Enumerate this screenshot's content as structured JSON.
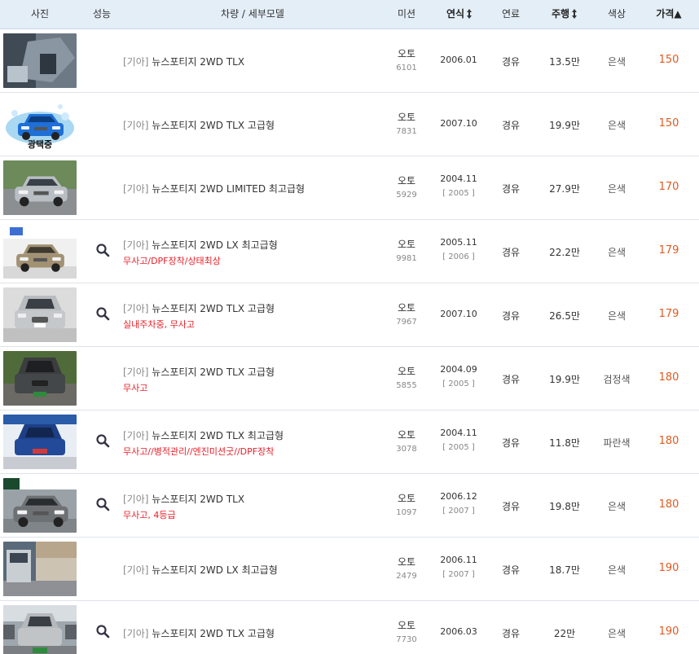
{
  "header": {
    "photo": "사진",
    "performance": "성능",
    "model": "차량 / 세부모델",
    "transmission": "미션",
    "year": "연식",
    "fuel": "연료",
    "mileage": "주행",
    "color": "색상",
    "price": "가격▲"
  },
  "rows": [
    {
      "maker": "[기아]",
      "model": "뉴스포티지 2WD TLX",
      "note": "",
      "trans": "오토",
      "code": "6101",
      "year": "2006.01",
      "year2": "",
      "fuel": "경유",
      "km": "13.5만",
      "color": "은색",
      "price": "150",
      "inspect": false,
      "thumb": "interior"
    },
    {
      "maker": "[기아]",
      "model": "뉴스포티지 2WD TLX 고급형",
      "note": "",
      "trans": "오토",
      "code": "7831",
      "year": "2007.10",
      "year2": "",
      "fuel": "경유",
      "km": "19.9만",
      "color": "은색",
      "price": "150",
      "inspect": false,
      "thumb": "wash",
      "thumb_label": "광택중"
    },
    {
      "maker": "[기아]",
      "model": "뉴스포티지 2WD LIMITED 최고급형",
      "note": "",
      "trans": "오토",
      "code": "5929",
      "year": "2004.11",
      "year2": "[ 2005 ]",
      "fuel": "경유",
      "km": "27.9만",
      "color": "은색",
      "price": "170",
      "inspect": false,
      "thumb": "silver"
    },
    {
      "maker": "[기아]",
      "model": "뉴스포티지 2WD LX 최고급형",
      "note": "무사고/DPF장착/상태최상",
      "trans": "오토",
      "code": "9981",
      "year": "2005.11",
      "year2": "[ 2006 ]",
      "fuel": "경유",
      "km": "22.2만",
      "color": "은색",
      "price": "179",
      "inspect": true,
      "thumb": "beige"
    },
    {
      "maker": "[기아]",
      "model": "뉴스포티지 2WD TLX 고급형",
      "note": "실내주차중, 무사고",
      "trans": "오토",
      "code": "7967",
      "year": "2007.10",
      "year2": "",
      "fuel": "경유",
      "km": "26.5만",
      "color": "은색",
      "price": "179",
      "inspect": true,
      "thumb": "front"
    },
    {
      "maker": "[기아]",
      "model": "뉴스포티지 2WD TLX 고급형",
      "note": "무사고",
      "trans": "오토",
      "code": "5855",
      "year": "2004.09",
      "year2": "[ 2005 ]",
      "fuel": "경유",
      "km": "19.9만",
      "color": "검정색",
      "price": "180",
      "inspect": false,
      "thumb": "dark"
    },
    {
      "maker": "[기아]",
      "model": "뉴스포티지 2WD TLX 최고급형",
      "note": "무사고//병적관리//엔진미션굿//DPF장착",
      "trans": "오토",
      "code": "3078",
      "year": "2004.11",
      "year2": "[ 2005 ]",
      "fuel": "경유",
      "km": "11.8만",
      "color": "파란색",
      "price": "180",
      "inspect": true,
      "thumb": "blue"
    },
    {
      "maker": "[기아]",
      "model": "뉴스포티지 2WD TLX",
      "note": "무사고, 4등급",
      "trans": "오토",
      "code": "1097",
      "year": "2006.12",
      "year2": "[ 2007 ]",
      "fuel": "경유",
      "km": "19.8만",
      "color": "은색",
      "price": "180",
      "inspect": true,
      "thumb": "lot"
    },
    {
      "maker": "[기아]",
      "model": "뉴스포티지 2WD LX 최고급형",
      "note": "",
      "trans": "오토",
      "code": "2479",
      "year": "2006.11",
      "year2": "[ 2007 ]",
      "fuel": "경유",
      "km": "18.7만",
      "color": "은색",
      "price": "190",
      "inspect": false,
      "thumb": "side"
    },
    {
      "maker": "[기아]",
      "model": "뉴스포티지 2WD TLX 고급형",
      "note": "",
      "trans": "오토",
      "code": "7730",
      "year": "2006.03",
      "year2": "",
      "fuel": "경유",
      "km": "22만",
      "color": "은색",
      "price": "190",
      "inspect": true,
      "thumb": "street"
    }
  ],
  "colors": {
    "header_bg": "#e4eef7",
    "price": "#e05a20",
    "note": "#e8202a"
  },
  "icons": {
    "inspect": "magnifier-icon",
    "sort": "sort-updown-icon"
  }
}
